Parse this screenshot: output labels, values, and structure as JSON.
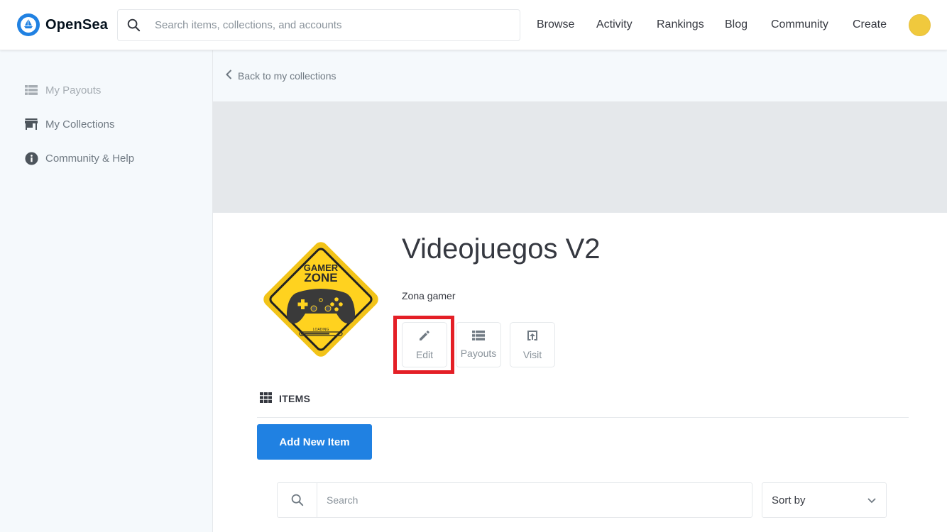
{
  "brand": {
    "name": "OpenSea"
  },
  "search": {
    "placeholder": "Search items, collections, and accounts"
  },
  "nav": {
    "items": [
      "Browse",
      "Activity",
      "Rankings",
      "Blog",
      "Community",
      "Create"
    ]
  },
  "sidebar": {
    "items": [
      {
        "label": "My Payouts",
        "icon": "list-icon",
        "state": "disabled"
      },
      {
        "label": "My Collections",
        "icon": "storefront-icon"
      },
      {
        "label": "Community & Help",
        "icon": "info-icon"
      }
    ]
  },
  "main": {
    "back_label": "Back to my collections",
    "collection": {
      "title": "Videojuegos V2",
      "description": "Zona gamer",
      "logo_text": [
        "GAMER",
        "ZONE",
        "LOADING"
      ]
    },
    "actions": [
      {
        "label": "Edit",
        "icon": "pencil-icon"
      },
      {
        "label": "Payouts",
        "icon": "list-icon"
      },
      {
        "label": "Visit",
        "icon": "external-link-icon"
      }
    ],
    "items_heading": "ITEMS",
    "add_button": "Add New Item",
    "items_search_placeholder": "Search",
    "sort_label": "Sort by"
  },
  "colors": {
    "accent": "#2081e2",
    "highlight": "#e41f26",
    "avatar": "#f0c93d"
  }
}
